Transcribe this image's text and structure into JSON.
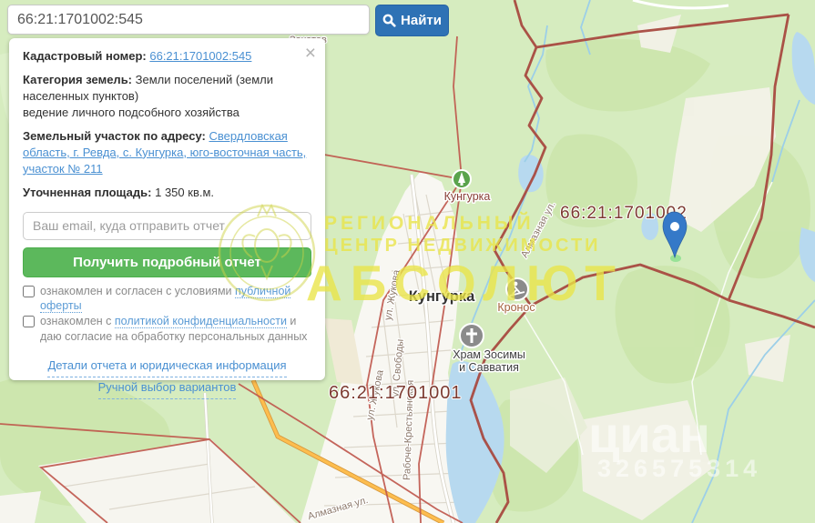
{
  "search": {
    "value": "66:21:1701002:545",
    "button_label": "Найти"
  },
  "panel": {
    "close_label": "×",
    "cadastral_label": "Кадастровый номер:",
    "cadastral_number": "66:21:1701002:545",
    "category_label": "Категория земель:",
    "category_value": "Земли поселений (земли населенных пунктов)",
    "category_extra": "ведение личного подсобного хозяйства",
    "address_label": "Земельный участок по адресу:",
    "address_link": "Свердловская область, г. Ревда, с. Кунгурка, юго-восточная часть, участок № 211",
    "area_label": "Уточненная площадь:",
    "area_value": "1 350 кв.м.",
    "email_placeholder": "Ваш email, куда отправить отчет",
    "submit_label": "Получить подробный отчет",
    "checkbox1": {
      "prefix": "ознакомлен и согласен с условиями ",
      "link": "публичной оферты"
    },
    "checkbox2": {
      "prefix": "ознакомлен с ",
      "link": "политикой конфиденциальности",
      "suffix": " и даю согласие на обработку персональных данных"
    },
    "links": {
      "details": "Детали отчета и юридическая информация",
      "manual": "Ручной выбор вариантов"
    }
  },
  "map": {
    "quarter_label_1": "66:21:1701002",
    "quarter_label_2": "66:21:1701001",
    "town_label": "Кунгурка",
    "poi_top_label": "Кунгурка",
    "kronos_label": "Кронос",
    "church_label_line1": "Храм Зосимы",
    "church_label_line2": "и Савватия",
    "street_almaznaya": "Алмазная ул.",
    "street_zhukova": "ул. Жукова",
    "street_svobody": "ул. Свободы",
    "street_raboche": "Рабоче-Крестьянская",
    "partial_label": "Захатов"
  },
  "watermarks": {
    "line1": "РЕГИОНАЛЬНЫЙ",
    "line2": "ЦЕНТР НЕДВИЖИМОСТИ",
    "line3": "АБСОЛЮТ",
    "cian": "циан",
    "cian_number": "326575314"
  },
  "colors": {
    "search_button": "#2e72b5",
    "submit_button": "#5cb85c",
    "link": "#4a90d2",
    "boundary_red": "#a84a40",
    "thin_red": "#bf564b",
    "quarter_label": "#7c3a30",
    "water": "#b7d9ef",
    "map_base": "#d6ecbf",
    "urban": "#f8f7f2",
    "orange_road": "#fdbd4e",
    "watermark_yellow": "#e9e446",
    "pin_blue": "#3579c8",
    "poi_green": "#5aa34c",
    "poi_gray": "#8b8b8b"
  }
}
